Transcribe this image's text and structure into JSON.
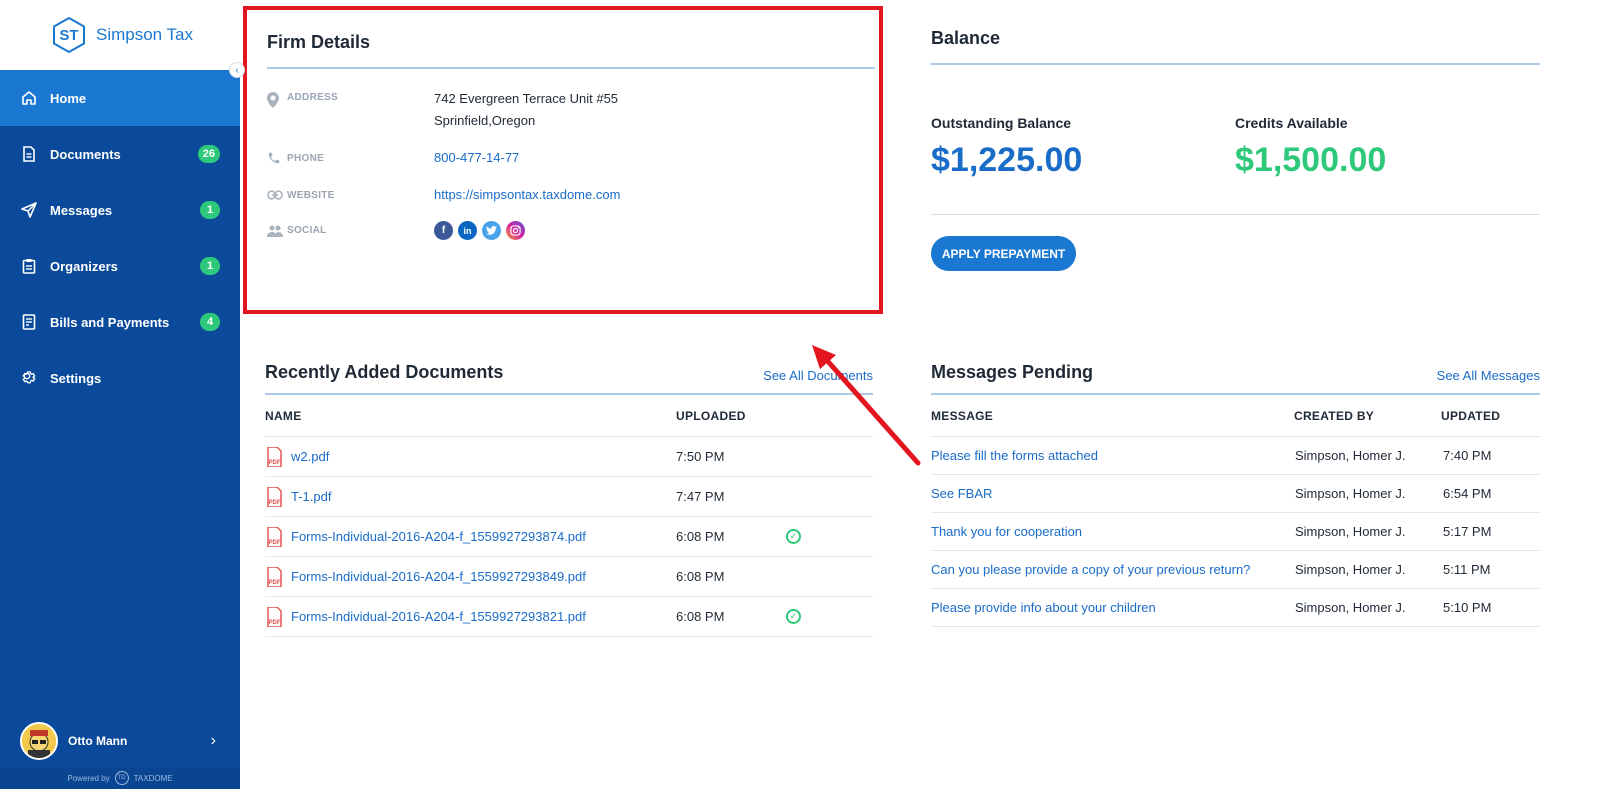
{
  "brand": {
    "initials": "ST",
    "name": "Simpson Tax"
  },
  "sidebar": {
    "items": [
      {
        "label": "Home",
        "icon": "home-icon",
        "badge": null,
        "active": true
      },
      {
        "label": "Documents",
        "icon": "document-icon",
        "badge": "26",
        "active": false
      },
      {
        "label": "Messages",
        "icon": "send-icon",
        "badge": "1",
        "active": false
      },
      {
        "label": "Organizers",
        "icon": "clipboard-icon",
        "badge": "1",
        "active": false
      },
      {
        "label": "Bills and Payments",
        "icon": "bill-icon",
        "badge": "4",
        "active": false
      },
      {
        "label": "Settings",
        "icon": "gear-icon",
        "badge": null,
        "active": false
      }
    ],
    "user": {
      "name": "Otto Mann"
    },
    "powered_by": "Powered by",
    "powered_brand": "TAXDOME",
    "powered_mark": "TD"
  },
  "firm": {
    "title": "Firm Details",
    "address_label": "ADDRESS",
    "address_line1": "742 Evergreen Terrace Unit #55",
    "address_line2": "Sprinfield,Oregon",
    "phone_label": "PHONE",
    "phone": "800-477-14-77",
    "website_label": "WEBSITE",
    "website": "https://simpsontax.taxdome.com",
    "social_label": "SOCIAL",
    "social": [
      "facebook",
      "linkedin",
      "twitter",
      "instagram"
    ]
  },
  "balance": {
    "title": "Balance",
    "outstanding_label": "Outstanding Balance",
    "outstanding_value": "$1,225.00",
    "credits_label": "Credits Available",
    "credits_value": "$1,500.00",
    "button": "APPLY PREPAYMENT",
    "colors": {
      "outstanding": "#1a6cc9",
      "credits": "#2ec87a"
    }
  },
  "documents": {
    "title": "Recently Added Documents",
    "see_all": "See All Documents",
    "columns": [
      "NAME",
      "UPLOADED"
    ],
    "rows": [
      {
        "name": "w2.pdf",
        "uploaded": "7:50 PM",
        "checked": false
      },
      {
        "name": "T-1.pdf",
        "uploaded": "7:47 PM",
        "checked": false
      },
      {
        "name": "Forms-Individual-2016-A204-f_1559927293874.pdf",
        "uploaded": "6:08 PM",
        "checked": true
      },
      {
        "name": "Forms-Individual-2016-A204-f_1559927293849.pdf",
        "uploaded": "6:08 PM",
        "checked": false
      },
      {
        "name": "Forms-Individual-2016-A204-f_1559927293821.pdf",
        "uploaded": "6:08 PM",
        "checked": true
      }
    ]
  },
  "messages": {
    "title": "Messages Pending",
    "see_all": "See All Messages",
    "columns": [
      "MESSAGE",
      "CREATED BY",
      "UPDATED"
    ],
    "rows": [
      {
        "message": "Please fill the forms attached",
        "created_by": "Simpson, Homer J.",
        "updated": "7:40 PM"
      },
      {
        "message": "See FBAR",
        "created_by": "Simpson, Homer J.",
        "updated": "6:54 PM"
      },
      {
        "message": "Thank you for cooperation",
        "created_by": "Simpson, Homer J.",
        "updated": "5:17 PM"
      },
      {
        "message": "Can you please provide a copy of your previous return?",
        "created_by": "Simpson, Homer J.",
        "updated": "5:11 PM"
      },
      {
        "message": "Please provide info about your children",
        "created_by": "Simpson, Homer J.",
        "updated": "5:10 PM"
      }
    ]
  }
}
